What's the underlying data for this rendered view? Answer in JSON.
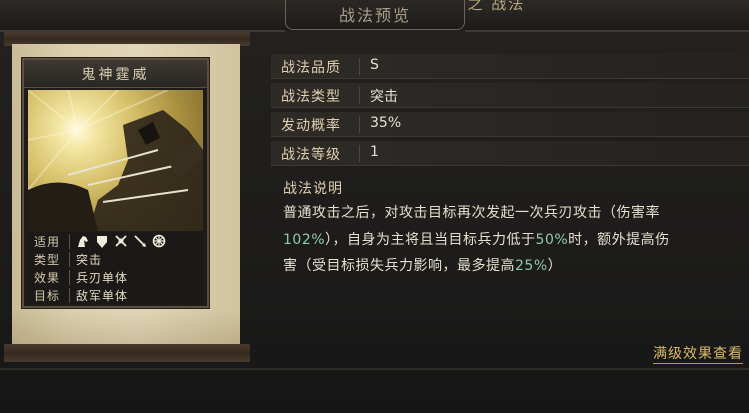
{
  "header": {
    "panel_title": "战法预览",
    "top_partial_text": "【  】 之  战法"
  },
  "card": {
    "name": "鬼神霆威",
    "stats": [
      {
        "label": "适用",
        "value": "",
        "icons": [
          "cavalry-icon",
          "shield-icon",
          "crossed-swords-icon",
          "spear-icon",
          "wheel-icon"
        ]
      },
      {
        "label": "类型",
        "value": "突击"
      },
      {
        "label": "效果",
        "value": "兵刃单体"
      },
      {
        "label": "目标",
        "value": "敌军单体"
      }
    ]
  },
  "info": {
    "rows": [
      {
        "label": "战法品质",
        "value": "S"
      },
      {
        "label": "战法类型",
        "value": "突击"
      },
      {
        "label": "发动概率",
        "value": "35%"
      },
      {
        "label": "战法等级",
        "value": "1"
      }
    ],
    "desc_title": "战法说明",
    "desc": {
      "line1": "普通攻击之后，对攻击目标再次发起一次兵刃攻击（伤害率",
      "line2_hl1": "102%",
      "line2_mid": "），自身为主将且当目标兵力低于",
      "line2_hl2": "50%",
      "line2_end": "时，额外提高伤",
      "line3_start": "害（受目标损失兵力影响，最多提高",
      "line3_hl": "25%",
      "line3_end": "）"
    },
    "full_level_link": "满级效果查看"
  },
  "colors": {
    "highlight": "#8fcaa8",
    "label_gold": "#e0cfae",
    "link_gold": "#d9b96c"
  }
}
